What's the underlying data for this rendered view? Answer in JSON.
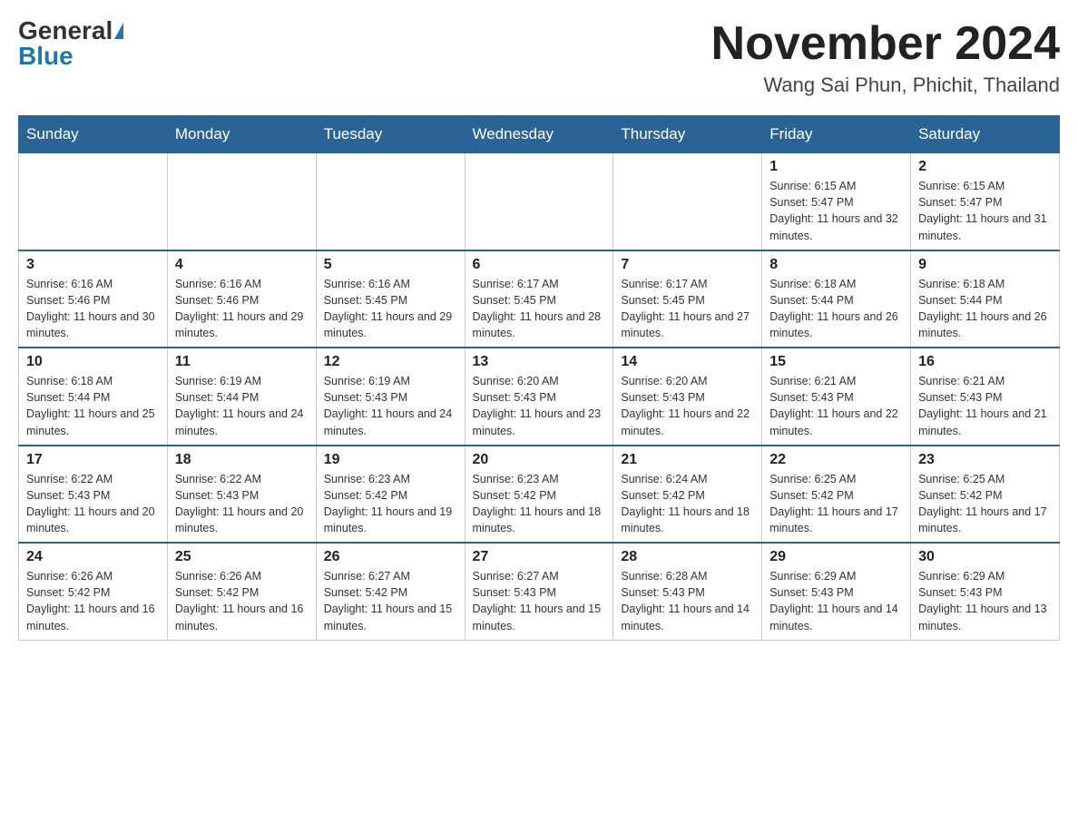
{
  "header": {
    "logo_general": "General",
    "logo_blue": "Blue",
    "month_title": "November 2024",
    "location": "Wang Sai Phun, Phichit, Thailand"
  },
  "weekdays": [
    "Sunday",
    "Monday",
    "Tuesday",
    "Wednesday",
    "Thursday",
    "Friday",
    "Saturday"
  ],
  "weeks": [
    [
      {
        "day": "",
        "info": ""
      },
      {
        "day": "",
        "info": ""
      },
      {
        "day": "",
        "info": ""
      },
      {
        "day": "",
        "info": ""
      },
      {
        "day": "",
        "info": ""
      },
      {
        "day": "1",
        "info": "Sunrise: 6:15 AM\nSunset: 5:47 PM\nDaylight: 11 hours and 32 minutes."
      },
      {
        "day": "2",
        "info": "Sunrise: 6:15 AM\nSunset: 5:47 PM\nDaylight: 11 hours and 31 minutes."
      }
    ],
    [
      {
        "day": "3",
        "info": "Sunrise: 6:16 AM\nSunset: 5:46 PM\nDaylight: 11 hours and 30 minutes."
      },
      {
        "day": "4",
        "info": "Sunrise: 6:16 AM\nSunset: 5:46 PM\nDaylight: 11 hours and 29 minutes."
      },
      {
        "day": "5",
        "info": "Sunrise: 6:16 AM\nSunset: 5:45 PM\nDaylight: 11 hours and 29 minutes."
      },
      {
        "day": "6",
        "info": "Sunrise: 6:17 AM\nSunset: 5:45 PM\nDaylight: 11 hours and 28 minutes."
      },
      {
        "day": "7",
        "info": "Sunrise: 6:17 AM\nSunset: 5:45 PM\nDaylight: 11 hours and 27 minutes."
      },
      {
        "day": "8",
        "info": "Sunrise: 6:18 AM\nSunset: 5:44 PM\nDaylight: 11 hours and 26 minutes."
      },
      {
        "day": "9",
        "info": "Sunrise: 6:18 AM\nSunset: 5:44 PM\nDaylight: 11 hours and 26 minutes."
      }
    ],
    [
      {
        "day": "10",
        "info": "Sunrise: 6:18 AM\nSunset: 5:44 PM\nDaylight: 11 hours and 25 minutes."
      },
      {
        "day": "11",
        "info": "Sunrise: 6:19 AM\nSunset: 5:44 PM\nDaylight: 11 hours and 24 minutes."
      },
      {
        "day": "12",
        "info": "Sunrise: 6:19 AM\nSunset: 5:43 PM\nDaylight: 11 hours and 24 minutes."
      },
      {
        "day": "13",
        "info": "Sunrise: 6:20 AM\nSunset: 5:43 PM\nDaylight: 11 hours and 23 minutes."
      },
      {
        "day": "14",
        "info": "Sunrise: 6:20 AM\nSunset: 5:43 PM\nDaylight: 11 hours and 22 minutes."
      },
      {
        "day": "15",
        "info": "Sunrise: 6:21 AM\nSunset: 5:43 PM\nDaylight: 11 hours and 22 minutes."
      },
      {
        "day": "16",
        "info": "Sunrise: 6:21 AM\nSunset: 5:43 PM\nDaylight: 11 hours and 21 minutes."
      }
    ],
    [
      {
        "day": "17",
        "info": "Sunrise: 6:22 AM\nSunset: 5:43 PM\nDaylight: 11 hours and 20 minutes."
      },
      {
        "day": "18",
        "info": "Sunrise: 6:22 AM\nSunset: 5:43 PM\nDaylight: 11 hours and 20 minutes."
      },
      {
        "day": "19",
        "info": "Sunrise: 6:23 AM\nSunset: 5:42 PM\nDaylight: 11 hours and 19 minutes."
      },
      {
        "day": "20",
        "info": "Sunrise: 6:23 AM\nSunset: 5:42 PM\nDaylight: 11 hours and 18 minutes."
      },
      {
        "day": "21",
        "info": "Sunrise: 6:24 AM\nSunset: 5:42 PM\nDaylight: 11 hours and 18 minutes."
      },
      {
        "day": "22",
        "info": "Sunrise: 6:25 AM\nSunset: 5:42 PM\nDaylight: 11 hours and 17 minutes."
      },
      {
        "day": "23",
        "info": "Sunrise: 6:25 AM\nSunset: 5:42 PM\nDaylight: 11 hours and 17 minutes."
      }
    ],
    [
      {
        "day": "24",
        "info": "Sunrise: 6:26 AM\nSunset: 5:42 PM\nDaylight: 11 hours and 16 minutes."
      },
      {
        "day": "25",
        "info": "Sunrise: 6:26 AM\nSunset: 5:42 PM\nDaylight: 11 hours and 16 minutes."
      },
      {
        "day": "26",
        "info": "Sunrise: 6:27 AM\nSunset: 5:42 PM\nDaylight: 11 hours and 15 minutes."
      },
      {
        "day": "27",
        "info": "Sunrise: 6:27 AM\nSunset: 5:43 PM\nDaylight: 11 hours and 15 minutes."
      },
      {
        "day": "28",
        "info": "Sunrise: 6:28 AM\nSunset: 5:43 PM\nDaylight: 11 hours and 14 minutes."
      },
      {
        "day": "29",
        "info": "Sunrise: 6:29 AM\nSunset: 5:43 PM\nDaylight: 11 hours and 14 minutes."
      },
      {
        "day": "30",
        "info": "Sunrise: 6:29 AM\nSunset: 5:43 PM\nDaylight: 11 hours and 13 minutes."
      }
    ]
  ]
}
